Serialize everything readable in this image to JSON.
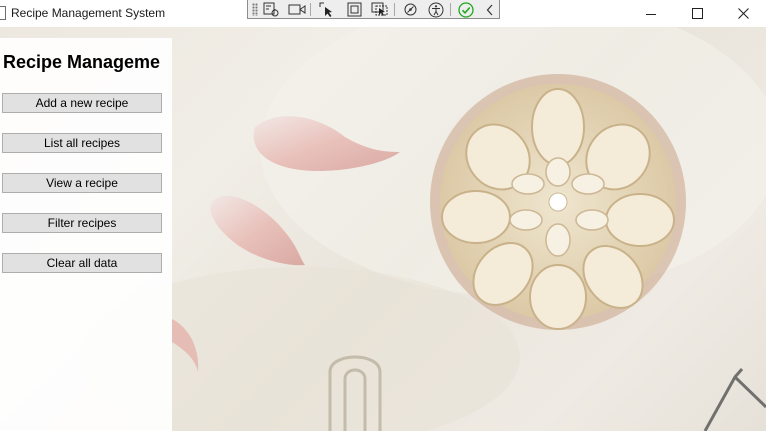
{
  "window": {
    "title": "Recipe Management System",
    "controls": {
      "minimize": "minimize-icon",
      "maximize": "maximize-icon",
      "close": "close-icon"
    }
  },
  "dev_toolbar": {
    "buttons": [
      "live-visual-tree-icon",
      "record-icon",
      "select-element-icon",
      "display-layout-adorners-icon",
      "track-focus-icon",
      "binding-failures-icon",
      "accessibility-icon",
      "hot-reload-ok-icon",
      "collapse-chevron-icon"
    ],
    "status_color": "#1fa81f"
  },
  "panel": {
    "heading": "Recipe Management",
    "buttons": [
      {
        "label": "Add a new recipe"
      },
      {
        "label": "List all recipes"
      },
      {
        "label": "View a recipe"
      },
      {
        "label": "Filter recipes"
      },
      {
        "label": "Clear all data"
      }
    ]
  },
  "colors": {
    "button_face": "#e1e1e1",
    "button_border": "#adadad",
    "background": "#ede8df"
  }
}
